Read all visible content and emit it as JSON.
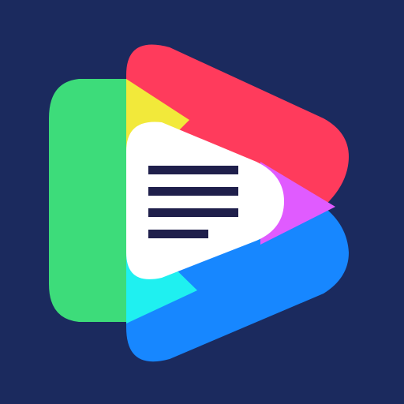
{
  "app_icon": {
    "background": "#1b2a5e",
    "colors": {
      "green": "#3ddc7a",
      "red": "#ff3b5c",
      "blue": "#1787ff",
      "yellow": "#f2e93a",
      "cyan": "#1ff0f0",
      "magenta": "#e05bff",
      "center": "#ffffff",
      "lines": "#1f1f4b"
    },
    "icon_name": "text-lines-play-logo"
  }
}
